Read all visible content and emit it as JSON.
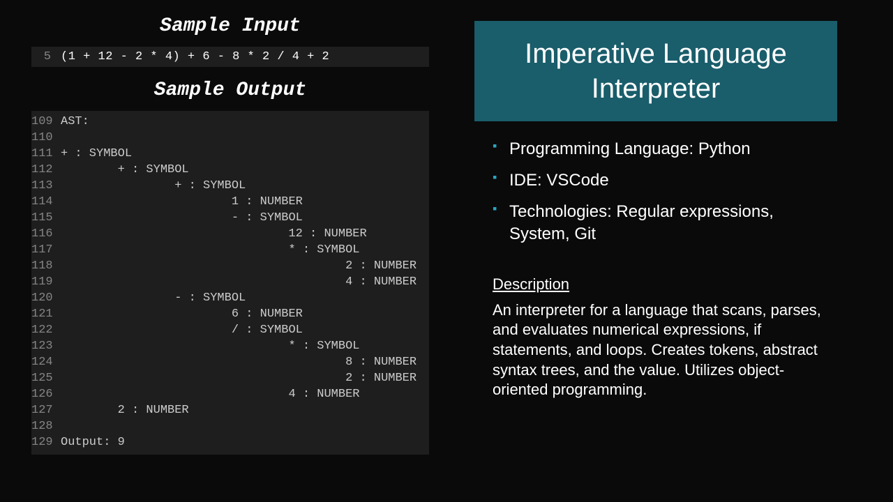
{
  "left": {
    "input_heading": "Sample Input",
    "output_heading": "Sample Output",
    "input": {
      "line_no": "5",
      "code": "(1 + 12 - 2 * 4) + 6 - 8 * 2 / 4 + 2"
    },
    "output_lines": [
      {
        "n": "109",
        "c": "AST:"
      },
      {
        "n": "110",
        "c": ""
      },
      {
        "n": "111",
        "c": "+ : SYMBOL"
      },
      {
        "n": "112",
        "c": "        + : SYMBOL"
      },
      {
        "n": "113",
        "c": "                + : SYMBOL"
      },
      {
        "n": "114",
        "c": "                        1 : NUMBER"
      },
      {
        "n": "115",
        "c": "                        - : SYMBOL"
      },
      {
        "n": "116",
        "c": "                                12 : NUMBER"
      },
      {
        "n": "117",
        "c": "                                * : SYMBOL"
      },
      {
        "n": "118",
        "c": "                                        2 : NUMBER"
      },
      {
        "n": "119",
        "c": "                                        4 : NUMBER"
      },
      {
        "n": "120",
        "c": "                - : SYMBOL"
      },
      {
        "n": "121",
        "c": "                        6 : NUMBER"
      },
      {
        "n": "122",
        "c": "                        / : SYMBOL"
      },
      {
        "n": "123",
        "c": "                                * : SYMBOL"
      },
      {
        "n": "124",
        "c": "                                        8 : NUMBER"
      },
      {
        "n": "125",
        "c": "                                        2 : NUMBER"
      },
      {
        "n": "126",
        "c": "                                4 : NUMBER"
      },
      {
        "n": "127",
        "c": "        2 : NUMBER"
      },
      {
        "n": "128",
        "c": ""
      },
      {
        "n": "129",
        "c": "Output: 9"
      }
    ]
  },
  "right": {
    "title": "Imperative Language Interpreter",
    "bullets": [
      "Programming Language: Python",
      "IDE: VSCode",
      "Technologies: Regular expressions, System, Git"
    ],
    "desc_heading": "Description",
    "desc_body": "An interpreter for a language that scans, parses, and evaluates numerical expressions, if statements, and loops. Creates tokens, abstract syntax trees, and the value. Utilizes object-oriented programming."
  }
}
